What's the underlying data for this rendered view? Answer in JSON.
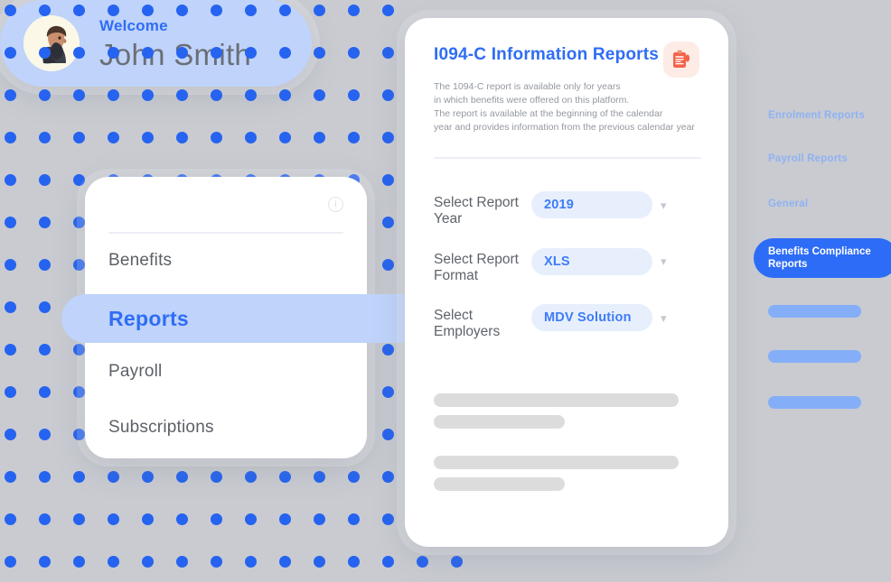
{
  "welcome": {
    "greeting": "Welcome",
    "user_name": "John Smith",
    "avatar_icon": "user-avatar-bearded-man",
    "background_color": "#bfd3fb",
    "accent_color": "#2f6df4"
  },
  "nav_card": {
    "info_icon": "info-circle-icon",
    "info_glyph": "i",
    "items": [
      {
        "label": "Benefits",
        "active": false
      },
      {
        "label": "Reports",
        "active": true
      },
      {
        "label": "Payroll",
        "active": false
      },
      {
        "label": "Subscriptions",
        "active": false
      }
    ],
    "active_background": "#bfd3fb",
    "active_text_color": "#2f6df4"
  },
  "report": {
    "title": "I094-C  Information Reports",
    "title_color": "#2f6df4",
    "badge_icon": "clipboard-icon",
    "badge_background": "#fdece6",
    "badge_color": "#f2634a",
    "description": "The 1094-C report is available only for years\nin which benefits were offered on this platform.\nThe report is available at the beginning of the calendar\nyear and provides information from the previous calendar year",
    "form": [
      {
        "label": "Select Report Year",
        "value": "2019",
        "chevron_icon": "chevron-down-icon"
      },
      {
        "label": "Select Report Format",
        "value": "XLS",
        "chevron_icon": "chevron-down-icon"
      },
      {
        "label": "Select Employers",
        "value": "MDV Solution",
        "chevron_icon": "chevron-down-icon"
      }
    ],
    "pill_background": "#e7effd",
    "pill_text_color": "#3d7cf6",
    "skeleton_groups": 2,
    "skeleton_color": "#dcdcdc"
  },
  "right_sidebar": {
    "links": [
      {
        "label": "Enrolment Reports",
        "active": false
      },
      {
        "label": "Payroll Reports",
        "active": false
      },
      {
        "label": "General",
        "active": false
      }
    ],
    "active_item": {
      "label": "Benefits Compliance Reports",
      "active": true
    },
    "link_color": "#8fb2f3",
    "active_background": "#2d6cf6",
    "active_text_color": "#ffffff",
    "placeholder_pills": 3,
    "pill_color": "#84aef8"
  },
  "background": {
    "color": "#c9cbd1",
    "dot_color": "#2563f0",
    "dot_pattern": "dot-grid"
  }
}
